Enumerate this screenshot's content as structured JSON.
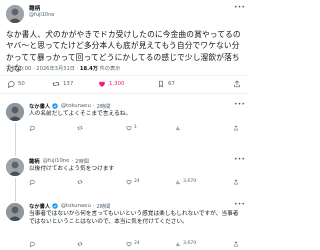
{
  "main_tweet": {
    "author_name": "雛柄",
    "author_handle": "@fuji10ne",
    "body": "なか書人、犬のかがやきでドカ受けしたのに今金曲の賞やってるのヤバ〜と思ってたけど多分本人も底が見えてもう自分でワケない分かってて暴っかって回ってどうにかしてるの感じで少し溜飲が落ちたな",
    "time": "午前10:00",
    "date": "2026年3月31日",
    "views_count": "18.4万",
    "views_label": "件の表示",
    "stats": {
      "replies": "50",
      "retweets": "137",
      "likes": "1,300",
      "bookmarks": "67"
    }
  },
  "replies": [
    {
      "name": "なか書人",
      "handle": "@tokunaeu",
      "time": "2時間",
      "body": "人の名前だしてよくそこまで言えるね。",
      "stats": {
        "replies": "",
        "retweets": "",
        "likes": "1",
        "views": ""
      }
    },
    {
      "name": "雛柄",
      "handle": "@fuji10ne",
      "time": "2時間",
      "body": "以後付けておくよう気をつけます",
      "stats": {
        "replies": "",
        "retweets": "",
        "likes": "24",
        "views": "3,670"
      }
    },
    {
      "name": "なか書人",
      "handle": "@tokunaeu",
      "time": "2時間",
      "body": "当事者ではないから何を言ってもいいという感覚は楽しもしれないですが、当事者ではないということはないので、本当に気を付けてください。",
      "stats": {
        "replies": "",
        "retweets": "",
        "likes": "24",
        "views": "3,670"
      }
    }
  ],
  "colors": {
    "text": "#0f1419",
    "muted": "#536471",
    "like": "#f91880",
    "verified": "#1d9bf0",
    "divider": "#eff3f4"
  },
  "icons": [
    "reply-icon",
    "retweet-icon",
    "heart-icon",
    "bookmark-icon",
    "share-icon",
    "views-icon",
    "more-icon",
    "verified-icon"
  ]
}
